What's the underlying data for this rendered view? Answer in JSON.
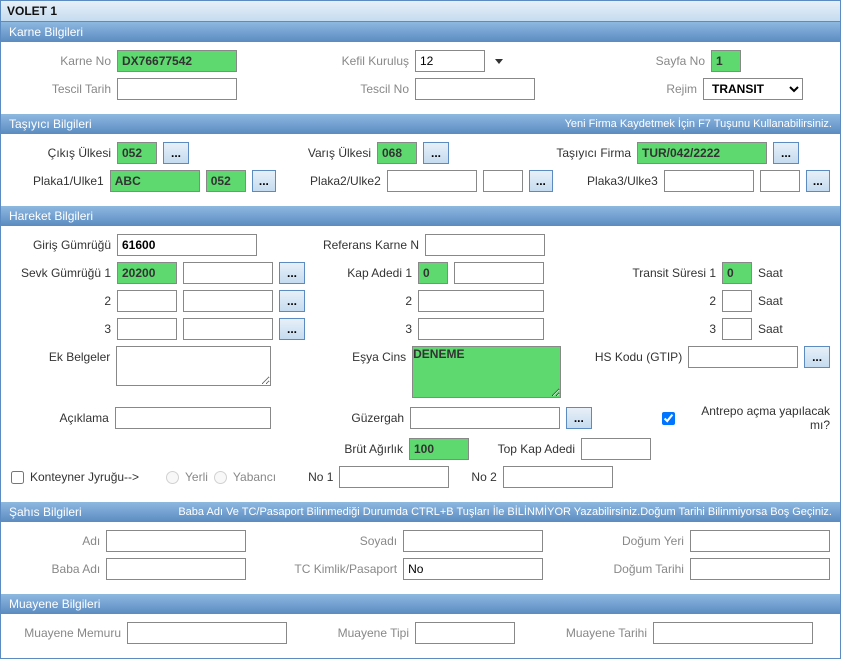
{
  "window": {
    "title": "VOLET 1"
  },
  "karne": {
    "header": "Karne Bilgileri",
    "karne_no_label": "Karne No",
    "karne_no": "DX76677542",
    "kefil_kurulus_label": "Kefil Kuruluş",
    "kefil_kurulus": "12",
    "sayfa_no_label": "Sayfa No",
    "sayfa_no": "1",
    "tescil_tarih_label": "Tescil Tarih",
    "tescil_tarih": "",
    "tescil_no_label": "Tescil No",
    "tescil_no": "",
    "rejim_label": "Rejim",
    "rejim": "TRANSIT"
  },
  "tasiyici": {
    "header": "Taşıyıcı Bilgileri",
    "hint": "Yeni Firma Kaydetmek İçin F7 Tuşunu Kullanabilirsiniz.",
    "cikis_ulkesi_label": "Çıkış Ülkesi",
    "cikis_ulkesi": "052",
    "varis_ulkesi_label": "Varış Ülkesi",
    "varis_ulkesi": "068",
    "tasiyici_firma_label": "Taşıyıcı Firma",
    "tasiyici_firma": "TUR/042/2222",
    "plaka1_label": "Plaka1/Ulke1",
    "plaka1": "ABC",
    "plaka1_ulke": "052",
    "plaka2_label": "Plaka2/Ulke2",
    "plaka2": "",
    "plaka3_label": "Plaka3/Ulke3",
    "plaka3": "",
    "lookup": "..."
  },
  "hareket": {
    "header": "Hareket Bilgileri",
    "giris_gumrugu_label": "Giriş Gümrüğü",
    "giris_gumrugu": "61600",
    "referans_karne_label": "Referans Karne N",
    "referans_karne": "",
    "sevk_gumrugu_label": "Sevk Gümrüğü 1",
    "sevk_gumrugu1_a": "20200",
    "sevk_gumrugu1_b": "",
    "row2_label": "2",
    "row3_label": "3",
    "kap_adedi_label": "Kap Adedi   1",
    "kap_adedi1": "0",
    "kap_row2_label": "2",
    "kap_row3_label": "3",
    "transit_suresi_label": "Transit Süresi   1",
    "transit_suresi1": "0",
    "saat_label": "Saat",
    "transit_row2_label": "2",
    "transit_row3_label": "3",
    "ek_belgeler_label": "Ek Belgeler",
    "esya_cins_label": "Eşya Cins",
    "esya_cins": "DENEME",
    "hs_kodu_label": "HS Kodu (GTIP)",
    "aciklama_label": "Açıklama",
    "guzergah_label": "Güzergah",
    "brut_agirlik_label": "Brüt Ağırlık",
    "brut_agirlik": "100",
    "top_kap_adedi_label": "Top Kap Adedi",
    "antrepo_label": "Antrepo açma yapılacak mı?",
    "konteyner_label": "Konteyner Jyruğu-->",
    "yerli_label": "Yerli",
    "yabanci_label": "Yabancı",
    "no1_label": "No 1",
    "no2_label": "No 2",
    "lookup": "..."
  },
  "sahis": {
    "header": "Şahıs Bilgileri",
    "hint": "Baba Adı Ve TC/Pasaport Bilinmediği Durumda CTRL+B Tuşları İle BİLİNMİYOR Yazabilirsiniz.Doğum Tarihi Bilinmiyorsa Boş Geçiniz.",
    "adi_label": "Adı",
    "soyadi_label": "Soyadı",
    "dogum_yeri_label": "Doğum Yeri",
    "baba_adi_label": "Baba Adı",
    "tc_label": "TC Kimlik/Pasaport",
    "tc_value": "No",
    "dogum_tarihi_label": "Doğum Tarihi"
  },
  "muayene": {
    "header": "Muayene Bilgileri",
    "memuru_label": "Muayene Memuru",
    "tipi_label": "Muayene Tipi",
    "tarihi_label": "Muayene Tarihi"
  }
}
